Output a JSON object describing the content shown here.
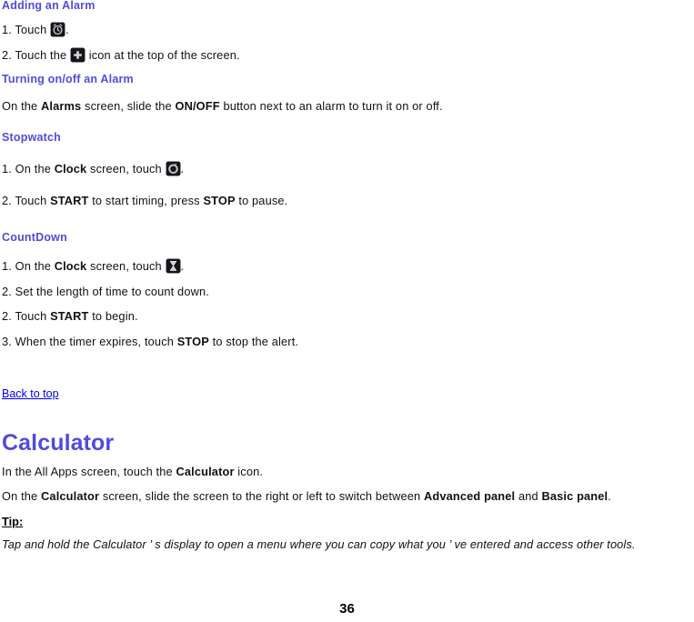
{
  "document": {
    "page_number": "36",
    "accent_heading_color": "#4f4ddb",
    "link_color": "#0000ee",
    "text_color": "#111111"
  },
  "sections": [
    {
      "id": "adding-an-alarm",
      "heading": "Adding an Alarm",
      "steps": [
        {
          "prefix": "1. Touch ",
          "icon": "alarm-clock-icon",
          "suffix": "."
        },
        {
          "prefix": "2. Touch the ",
          "icon": "plus-add-icon",
          "suffix": " icon at the top of the screen."
        }
      ]
    },
    {
      "id": "turning-on-off-an-alarm",
      "heading": "Turning on/off an Alarm",
      "body": {
        "part1": "On the ",
        "bold1": "Alarms",
        "part2": " screen, slide the ",
        "bold2": "ON/OFF",
        "part3": " button next to an alarm to turn it on or off."
      }
    },
    {
      "id": "stopwatch",
      "heading": "Stopwatch",
      "steps": [
        {
          "prefix": "1. On the ",
          "bold": "Clock",
          "middle": " screen, touch ",
          "icon": "stopwatch-icon",
          "suffix": "."
        },
        {
          "prefix": "2. Touch ",
          "bold": "START",
          "middle": " to start timing, press ",
          "bold2": "STOP",
          "suffix": " to pause."
        }
      ]
    },
    {
      "id": "countdown",
      "heading": "CountDown",
      "steps": [
        {
          "prefix": "1. On the ",
          "bold": "Clock",
          "middle": " screen, touch ",
          "icon": "hourglass-timer-icon",
          "suffix": "."
        },
        {
          "text": "2. Set the length of time to count down."
        },
        {
          "prefix": "2. Touch ",
          "bold": "START",
          "suffix": " to begin."
        },
        {
          "prefix": "3. When the timer expires, touch ",
          "bold": "STOP",
          "suffix": " to stop the alert."
        }
      ]
    }
  ],
  "back_to_top": {
    "label": "Back to top"
  },
  "calculator": {
    "heading": "Calculator",
    "line1": {
      "part1": "In the All Apps screen, touch the ",
      "bold1": "Calculator",
      "part2": " icon."
    },
    "line2": {
      "part1": "On the ",
      "bold1": "Calculator",
      "part2": " screen, slide the screen to the right or left to switch between ",
      "bold2": "Advanced panel",
      "part3": " and ",
      "bold3": "Basic panel",
      "part4": "."
    },
    "tip_label": "Tip:",
    "tip_text": "Tap and hold the Calculator ’ s display to open a menu where you can copy what you ’ ve entered and access other tools."
  }
}
